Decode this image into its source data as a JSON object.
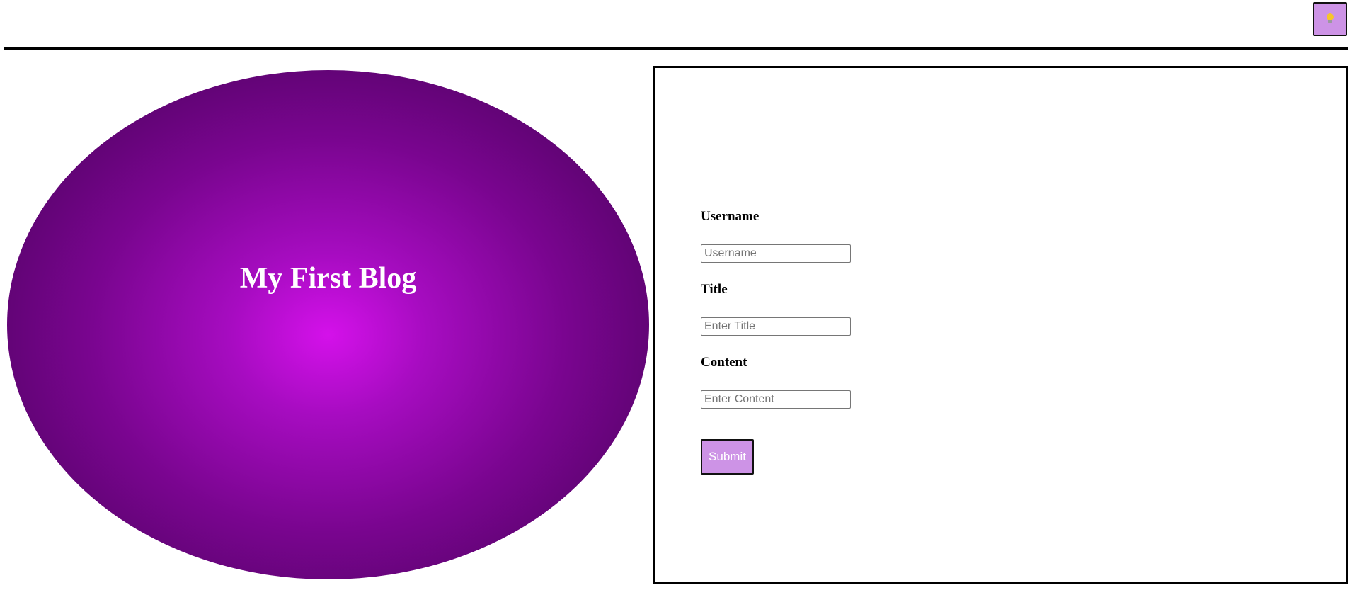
{
  "header": {
    "theme_toggle_icon": "lightbulb-icon"
  },
  "hero": {
    "title": "My First Blog"
  },
  "form": {
    "fields": [
      {
        "label": "Username",
        "placeholder": "Username",
        "value": ""
      },
      {
        "label": "Title",
        "placeholder": "Enter Title",
        "value": ""
      },
      {
        "label": "Content",
        "placeholder": "Enter Content",
        "value": ""
      }
    ],
    "submit_label": "Submit"
  },
  "colors": {
    "accent": "#cd93e6",
    "hero_center": "#d411ea",
    "hero_edge": "#3f0350",
    "bulb": "#f6c52a"
  }
}
